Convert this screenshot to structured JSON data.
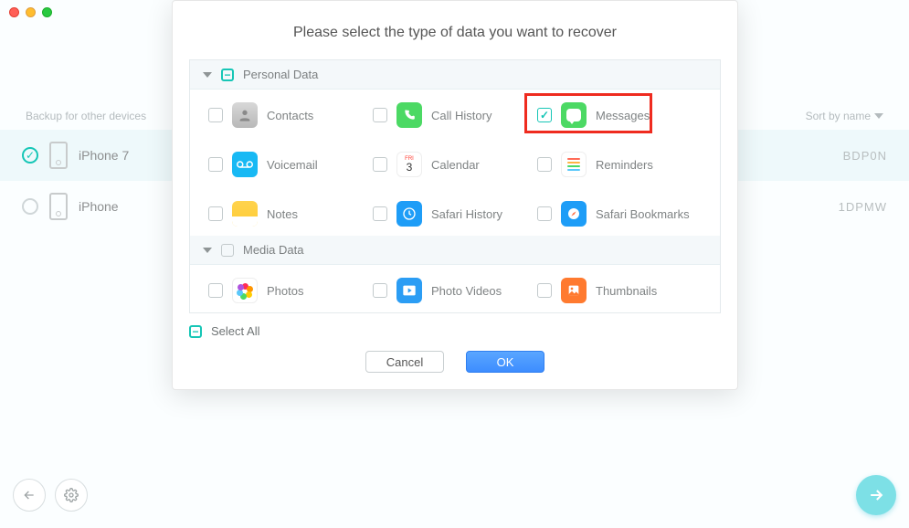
{
  "traffic": {
    "close": "close",
    "min": "minimize",
    "max": "maximize"
  },
  "back_list": {
    "left_label": "Backup for other devices",
    "sort_label": "Sort by name",
    "devices": [
      {
        "name": "iPhone 7",
        "id_tail": "BDP0N",
        "selected": true
      },
      {
        "name": "iPhone",
        "id_tail": "1DPMW",
        "selected": false
      }
    ]
  },
  "nav": {
    "back": "Back",
    "settings": "Settings",
    "next": "Next"
  },
  "modal": {
    "title": "Please select the type of data you want to recover",
    "sections": [
      {
        "title": "Personal Data",
        "items": [
          {
            "label": "Contacts",
            "icon": "contacts",
            "checked": false
          },
          {
            "label": "Call History",
            "icon": "phone",
            "checked": false
          },
          {
            "label": "Messages",
            "icon": "msg",
            "checked": true,
            "highlight": true
          },
          {
            "label": "Voicemail",
            "icon": "voicemail",
            "checked": false
          },
          {
            "label": "Calendar",
            "icon": "calendar",
            "checked": false
          },
          {
            "label": "Reminders",
            "icon": "reminders",
            "checked": false
          },
          {
            "label": "Notes",
            "icon": "notes",
            "checked": false
          },
          {
            "label": "Safari History",
            "icon": "safari",
            "checked": false
          },
          {
            "label": "Safari Bookmarks",
            "icon": "bookmark",
            "checked": false
          }
        ]
      },
      {
        "title": "Media Data",
        "items": [
          {
            "label": "Photos",
            "icon": "photos",
            "checked": false
          },
          {
            "label": "Photo Videos",
            "icon": "pvideo",
            "checked": false
          },
          {
            "label": "Thumbnails",
            "icon": "thumb",
            "checked": false
          }
        ]
      }
    ],
    "select_all": "Select All",
    "cancel": "Cancel",
    "ok": "OK"
  }
}
